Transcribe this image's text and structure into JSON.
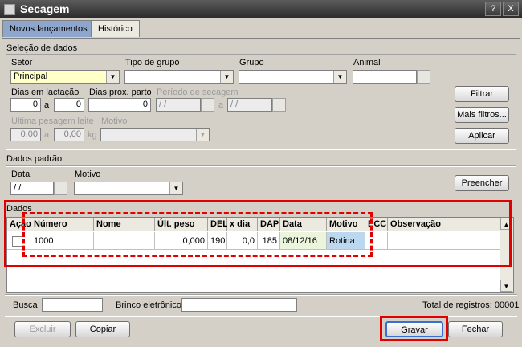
{
  "window": {
    "title": "Secagem",
    "controls": {
      "help": "?",
      "close": "X"
    }
  },
  "tabs": [
    {
      "label": "Novos lançamentos"
    },
    {
      "label": "Histórico"
    }
  ],
  "selecao": {
    "title": "Seleção de dados",
    "setor": {
      "label": "Setor",
      "value": "Principal"
    },
    "tipo_grupo": {
      "label": "Tipo de grupo",
      "value": ""
    },
    "grupo": {
      "label": "Grupo",
      "value": ""
    },
    "animal": {
      "label": "Animal",
      "value": ""
    },
    "dias_lactacao": {
      "label": "Dias em lactação",
      "from": "0",
      "sep": "a",
      "to": "0"
    },
    "dias_parto": {
      "label": "Dias prox. parto",
      "value": "0"
    },
    "periodo": {
      "label": "Período de secagem",
      "from": "/ /",
      "sep": "a",
      "to": "/ /"
    },
    "ultima_pesagem": {
      "label": "Última pesagem leite",
      "from": "0,00",
      "sep": "a",
      "to": "0,00",
      "unit": "kg"
    },
    "motivo": {
      "label": "Motivo",
      "value": ""
    },
    "buttons": {
      "filtrar": "Filtrar",
      "mais_filtros": "Mais filtros...",
      "aplicar": "Aplicar"
    }
  },
  "padrao": {
    "title": "Dados padrão",
    "data": {
      "label": "Data",
      "value": "/ /"
    },
    "motivo": {
      "label": "Motivo",
      "value": ""
    },
    "preencher": "Preencher"
  },
  "dados": {
    "title": "Dados",
    "columns": [
      "Ação",
      "Número",
      "Nome",
      "Últ. peso",
      "DEL",
      "x dia",
      "DAP",
      "Data",
      "Motivo",
      "ECC",
      "Observação"
    ],
    "rows": [
      {
        "acao": "",
        "numero": "1000",
        "nome": "",
        "ult_peso": "0,000",
        "del": "190",
        "x_dia": "0,0",
        "dap": "185",
        "data": "08/12/16",
        "motivo": "Rotina",
        "ecc": "",
        "obs": ""
      }
    ]
  },
  "footer": {
    "busca_label": "Busca",
    "busca_value": "",
    "brinco_label": "Brinco eletrônico",
    "brinco_value": "",
    "total_label": "Total de registros: 00001",
    "excluir": "Excluir",
    "copiar": "Copiar",
    "gravar": "Gravar",
    "fechar": "Fechar"
  }
}
